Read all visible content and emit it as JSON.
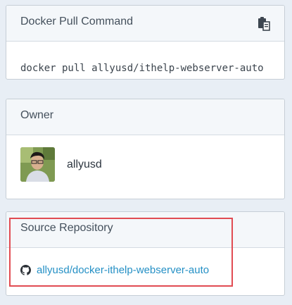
{
  "docker_pull": {
    "title": "Docker Pull Command",
    "command": "docker pull allyusd/ithelp-webserver-auto",
    "copy_icon": "copy-clipboard-icon"
  },
  "owner": {
    "title": "Owner",
    "name": "allyusd",
    "avatar_icon": "user-avatar-photo"
  },
  "source_repository": {
    "title": "Source Repository",
    "link_text": "allyusd/docker-ithelp-webserver-auto",
    "icon": "github-icon"
  },
  "colors": {
    "link": "#2590c5",
    "highlight_border": "#e14b52",
    "page_background": "#e8eef5",
    "panel_header_background": "#f4f7fa"
  }
}
